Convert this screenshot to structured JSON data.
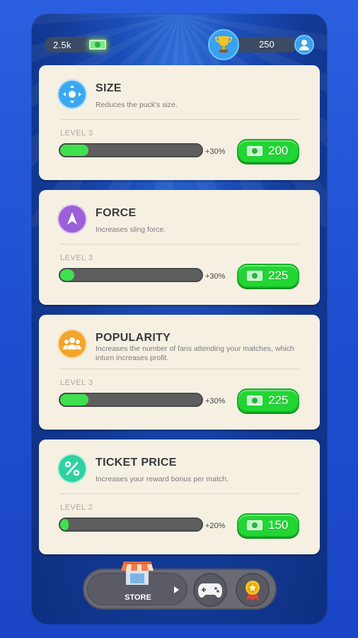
{
  "header": {
    "cash": "2.5k",
    "score": "250",
    "cash_icon": "cash-bill-icon",
    "trophy_icon": "trophy-icon",
    "avatar_icon": "user-avatar-icon"
  },
  "upgrades": [
    {
      "title": "SIZE",
      "description": "Reduces the puck's size.",
      "level": "LEVEL 3",
      "progress": 0.2,
      "bonus": "+30%",
      "price": "200",
      "icon": "size-arrows-icon",
      "icon_color": "#3aa8f0"
    },
    {
      "title": "FORCE",
      "description": "Increases sling force.",
      "level": "LEVEL 3",
      "progress": 0.1,
      "bonus": "+30%",
      "price": "225",
      "icon": "force-arrow-icon",
      "icon_color": "#9b5fd8"
    },
    {
      "title": "POPULARITY",
      "description": "Increases the number of fans attending your matches, which inturn increases profit.",
      "level": "LEVEL 3",
      "progress": 0.2,
      "bonus": "+30%",
      "price": "225",
      "icon": "fans-icon",
      "icon_color": "#f2a52b"
    },
    {
      "title": "TICKET PRICE",
      "description": "Increases your reward bonus per match.",
      "level": "LEVEL 2",
      "progress": 0.06,
      "bonus": "+20%",
      "price": "150",
      "icon": "percent-icon",
      "icon_color": "#2fd1a1"
    }
  ],
  "nav": {
    "store_label": "STORE",
    "store_icon": "store-icon",
    "play_icon": "gamepad-icon",
    "achievements_icon": "medal-icon"
  },
  "colors": {
    "button_green": "#22d534",
    "bar_fill": "#3fe04f",
    "card_bg": "#f6f0e3"
  }
}
